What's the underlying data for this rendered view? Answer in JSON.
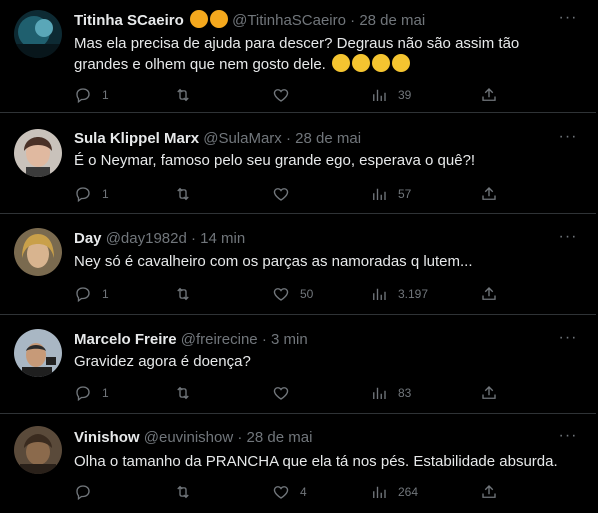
{
  "colors": {
    "background": "#000000",
    "text_primary": "#e7e9ea",
    "text_secondary": "#71767b",
    "divider": "#2f3336"
  },
  "tweets": [
    {
      "name": "Titinha SCaeiro",
      "name_emojis": [
        "🤭",
        "🤭"
      ],
      "handle": "@TitinhaSCaeiro",
      "separator": "·",
      "time": "28 de mai",
      "text": "Mas ela precisa de ajuda para descer? Degraus não são assim tão grandes e olhem que nem gosto dele.",
      "text_emojis": [
        "🙄",
        "🙄",
        "🙄",
        "🙄"
      ],
      "replies": "1",
      "retweets": "",
      "likes": "",
      "views": "39"
    },
    {
      "name": "Sula Klippel Marx",
      "handle": "@SulaMarx",
      "separator": "·",
      "time": "28 de mai",
      "text": "É o Neymar, famoso pelo seu grande ego, esperava o quê?!",
      "replies": "1",
      "retweets": "",
      "likes": "",
      "views": "57"
    },
    {
      "name": "Day",
      "handle": "@day1982d",
      "separator": "·",
      "time": "14 min",
      "text": "Ney só é cavalheiro com os parças as namoradas q lutem...",
      "replies": "1",
      "retweets": "",
      "likes": "50",
      "views": "3.197"
    },
    {
      "name": "Marcelo Freire",
      "handle": "@freirecine",
      "separator": "·",
      "time": "3 min",
      "text": "Gravidez agora é doença?",
      "replies": "1",
      "retweets": "",
      "likes": "",
      "views": "83"
    },
    {
      "name": "Vinishow",
      "handle": "@euvinishow",
      "separator": "·",
      "time": "28 de mai",
      "text": "Olha o tamanho da PRANCHA que ela tá nos pés. Estabilidade absurda.",
      "replies": "",
      "retweets": "",
      "likes": "4",
      "views": "264"
    }
  ],
  "icons": {
    "reply": "reply-icon",
    "retweet": "retweet-icon",
    "like": "heart-icon",
    "views": "views-icon",
    "share": "share-icon",
    "more": "more-icon"
  }
}
